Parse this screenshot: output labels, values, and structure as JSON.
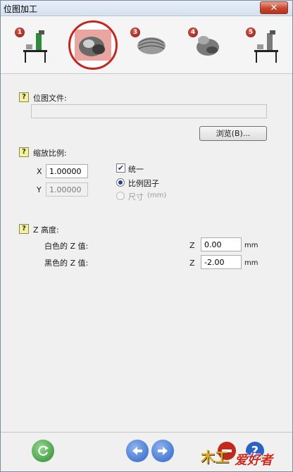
{
  "window": {
    "title": "位图加工",
    "close_icon": "close-x-icon"
  },
  "steps": [
    {
      "number": "1",
      "icon": "machine-table-icon"
    },
    {
      "number": "",
      "icon": "bitmap-thumbnail-icon",
      "active": true
    },
    {
      "number": "3",
      "icon": "relief-mesh-icon"
    },
    {
      "number": "4",
      "icon": "relief-model-icon"
    },
    {
      "number": "5",
      "icon": "machine-table-icon"
    }
  ],
  "bitmap_section": {
    "help": "?",
    "label": "位图文件:",
    "path_value": "",
    "browse_label": "浏览(B)..."
  },
  "scale_section": {
    "help": "?",
    "label": "缩放比例:",
    "x_label": "X",
    "x_value": "1.00000",
    "y_label": "Y",
    "y_value": "1.00000",
    "uniform_label": "统一",
    "uniform_checked": true,
    "options": [
      {
        "label": "比例因子",
        "selected": true,
        "disabled": false
      },
      {
        "label": "尺寸",
        "unit": "(mm)",
        "selected": false,
        "disabled": true
      }
    ]
  },
  "z_section": {
    "help": "?",
    "label": "Z 高度:",
    "white_label": "白色的 Z 值:",
    "white_axis": "Z",
    "white_value": "0.00",
    "white_unit": "mm",
    "black_label": "黑色的 Z 值:",
    "black_axis": "Z",
    "black_value": "-2.00",
    "black_unit": "mm"
  },
  "footer": {
    "refresh_icon": "refresh-icon",
    "back_icon": "arrow-left-icon",
    "next_icon": "arrow-right-icon",
    "close_icon": "stop-icon",
    "help_icon": "help-icon",
    "logo_text": "爱好者",
    "logo_mark": "木工"
  },
  "colors": {
    "accent_red": "#c2281e",
    "nav_blue": "#2a63c6",
    "green": "#3a9a3a"
  }
}
